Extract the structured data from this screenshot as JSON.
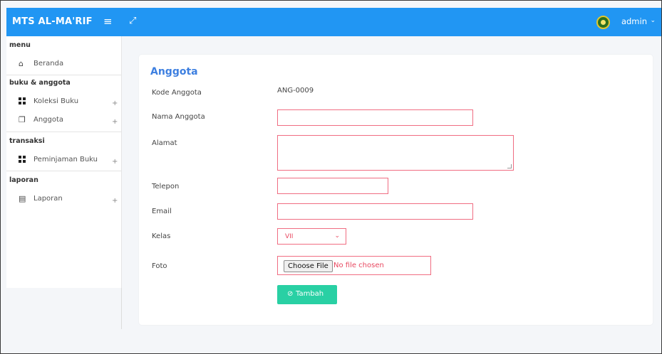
{
  "header": {
    "brand": "MTS AL-MA'RIF",
    "user": "admin"
  },
  "sidebar": {
    "sections": [
      {
        "title": "menu",
        "items": [
          {
            "label": "Beranda",
            "icon": "home-icon"
          }
        ]
      },
      {
        "title": "buku & anggota",
        "items": [
          {
            "label": "Koleksi Buku",
            "icon": "grid-icon"
          },
          {
            "label": "Anggota",
            "icon": "members-icon"
          }
        ]
      },
      {
        "title": "transaksi",
        "items": [
          {
            "label": "Peminjaman Buku",
            "icon": "grid-icon"
          }
        ]
      },
      {
        "title": "laporan",
        "items": [
          {
            "label": "Laporan",
            "icon": "report-icon"
          }
        ]
      }
    ],
    "plus": "+"
  },
  "form": {
    "title": "Anggota",
    "kode_label": "Kode Anggota",
    "kode_value": "ANG-0009",
    "nama_label": "Nama Anggota",
    "nama_value": "",
    "alamat_label": "Alamat",
    "alamat_value": "",
    "telepon_label": "Telepon",
    "telepon_value": "",
    "email_label": "Email",
    "email_value": "",
    "kelas_label": "Kelas",
    "kelas_selected": "VII",
    "foto_label": "Foto",
    "file_button": "Choose File",
    "file_status": "No file chosen",
    "submit_label": "Tambah"
  },
  "colors": {
    "header": "#2196f3",
    "accent_title": "#3d7fe0",
    "input_border": "#f06d82",
    "submit": "#29d0a4"
  }
}
